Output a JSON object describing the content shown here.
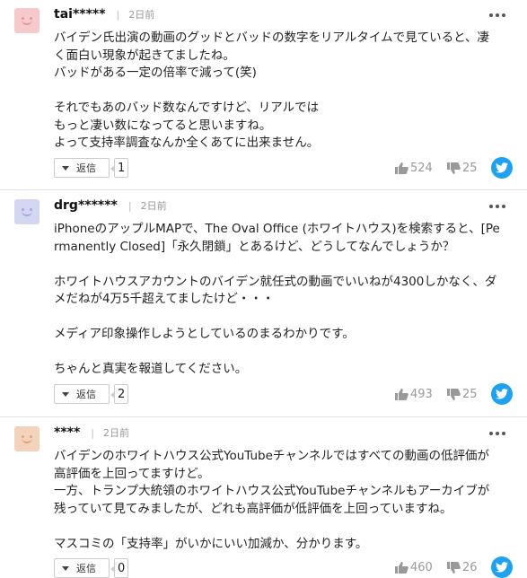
{
  "comments": [
    {
      "user": "tai*****",
      "separator": "|",
      "time": "2日前",
      "avatar_bg": "#f6c9cb",
      "avatar_fg": "#e79598",
      "lines": [
        "バイデン氏出演の動画のグッドとバッドの数字をリアルタイムで見ていると、凄",
        "く面白い現象が起きてましたね。",
        "バッドがある一定の倍率で減って(笑)",
        "",
        "それでもあのバッド数なんですけど、リアルでは",
        "もっと凄い数になってると思いますね。",
        "よって支持率調査なんか全くあてに出来ません。"
      ],
      "reply_label": "返信",
      "reply_count": "1",
      "likes": "524",
      "dislikes": "25"
    },
    {
      "user": "drg******",
      "separator": "|",
      "time": "2日前",
      "avatar_bg": "#d4d7f2",
      "avatar_fg": "#a4a8d8",
      "lines": [
        "iPhoneのアップルMAPで、The Oval Office (ホワイトハウス)を検索すると、[Pe",
        "rmanently Closed]「永久閉鎖」とあるけど、どうしてなんでしょうか？",
        "",
        "ホワイトハウスアカウントのバイデン就任式の動画でいいねが4300しかなく、ダ",
        "メだねが4万5千超えてましたけど・・・",
        "",
        "メディア印象操作しようとしているのまるわかりです。",
        "",
        "ちゃんと真実を報道してください。"
      ],
      "reply_label": "返信",
      "reply_count": "2",
      "likes": "493",
      "dislikes": "25"
    },
    {
      "user": "****",
      "separator": "|",
      "time": "2日前",
      "avatar_bg": "#f4d3bd",
      "avatar_fg": "#e2a27c",
      "lines": [
        "バイデンのホワイトハウス公式YouTubeチャンネルではすべての動画の低評価が",
        "高評価を上回ってますけど。",
        "一方、トランプ大統領のホワイトハウス公式YouTubeチャンネルもアーカイブが",
        "残っていて見てみましたが、どれも高評価が低評価を上回っていますね。",
        "",
        "マスコミの「支持率」がいかにいい加減か、分かります。"
      ],
      "reply_label": "返信",
      "reply_count": "0",
      "likes": "460",
      "dislikes": "26"
    }
  ],
  "icons": {
    "more": "more-options-icon",
    "reply_caret": "caret-down-icon",
    "like": "thumbs-up-icon",
    "dislike": "thumbs-down-icon",
    "share": "twitter-icon"
  },
  "colors": {
    "twitter_blue": "#1da1f2",
    "vote_gray": "#999999"
  }
}
